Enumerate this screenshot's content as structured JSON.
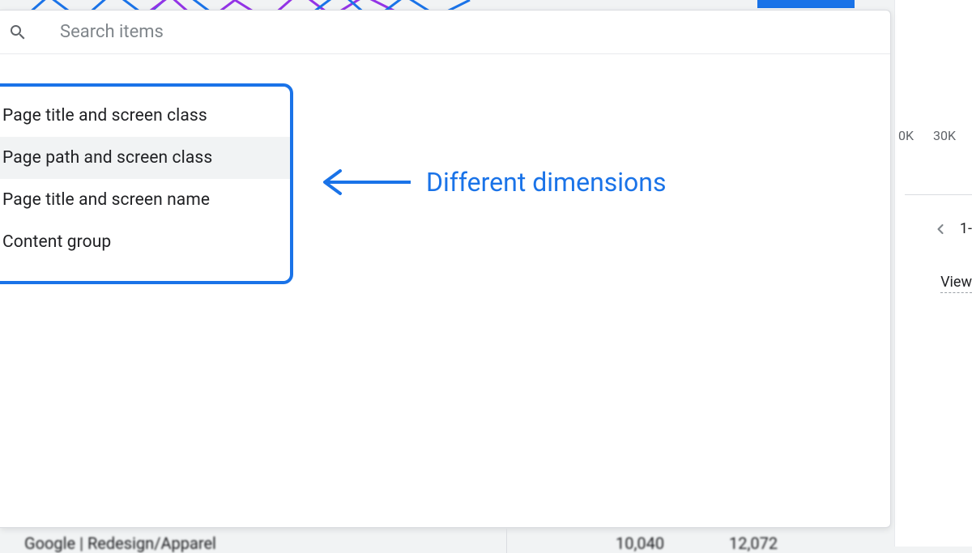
{
  "search": {
    "placeholder": "Search items"
  },
  "dimensions": {
    "items": [
      {
        "label": "Page title and screen class",
        "selected": false
      },
      {
        "label": "Page path and screen class",
        "selected": true
      },
      {
        "label": "Page title and screen name",
        "selected": false
      },
      {
        "label": "Content group",
        "selected": false
      }
    ]
  },
  "annotation": {
    "label": "Different dimensions"
  },
  "right": {
    "scale": [
      "0K",
      "30K"
    ],
    "pagination_fragment": "1-",
    "column_header": "View"
  },
  "bottom": {
    "path_fragment": "Google | Redesign/Apparel",
    "value1": "10,040",
    "value2": "12,072"
  }
}
